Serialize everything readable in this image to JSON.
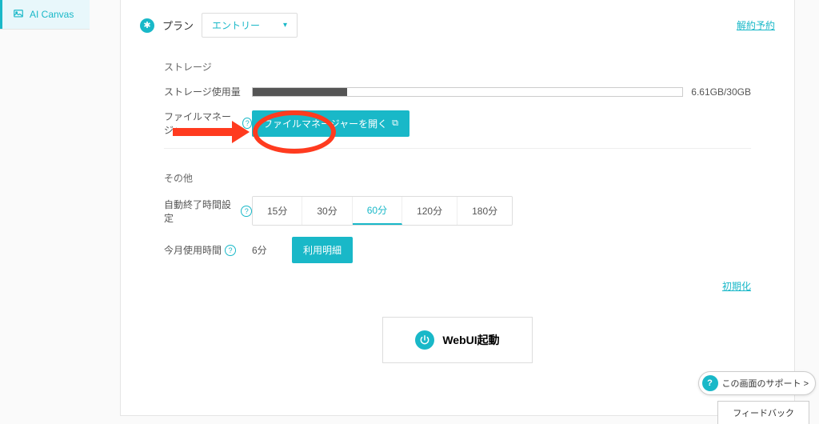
{
  "sidebar": {
    "items": [
      {
        "label": "AI Canvas"
      }
    ]
  },
  "plan": {
    "label": "プラン",
    "select_value": "エントリー",
    "cancel_link": "解約予約"
  },
  "storage": {
    "title": "ストレージ",
    "usage_label": "ストレージ使用量",
    "usage_text": "6.61GB/30GB",
    "usage_percent": 22,
    "fm_label": "ファイルマネージャー",
    "fm_button": "ファイルマネージャーを開く"
  },
  "other": {
    "title": "その他",
    "auto_end_label": "自動終了時間設定",
    "timeout_options": [
      "15分",
      "30分",
      "60分",
      "120分",
      "180分"
    ],
    "timeout_active": "60分",
    "usage_label": "今月使用時間",
    "usage_value": "6分",
    "detail_button": "利用明細",
    "init_link": "初期化"
  },
  "webui": {
    "label": "WebUI起動"
  },
  "footer": {
    "support": "この画面のサポート >",
    "feedback": "フィードバック"
  }
}
